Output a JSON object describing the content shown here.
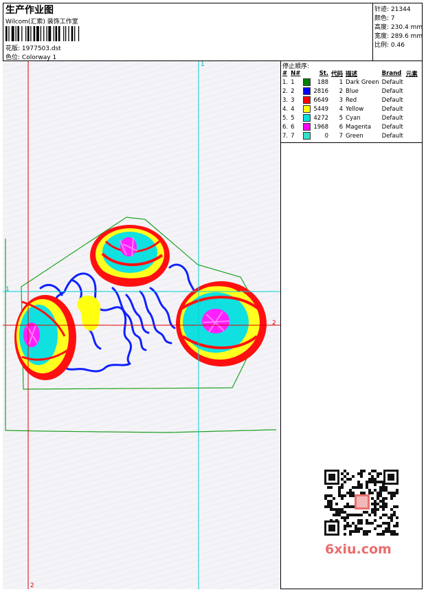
{
  "header": {
    "title": "生产作业图",
    "company": "Wilcom(汇索) 装饰工作室",
    "pattern_label": "花版:",
    "pattern_value": "1977503.dst",
    "colorway_label": "色位:",
    "colorway_value": "Colorway 1"
  },
  "stats": [
    {
      "label": "针迹:",
      "value": "21344"
    },
    {
      "label": "颜色:",
      "value": "7"
    },
    {
      "label": "高度:",
      "value": "230.4 mm"
    },
    {
      "label": "宽度:",
      "value": "289.6 mm"
    },
    {
      "label": "比例:",
      "value": "0.46"
    }
  ],
  "stop_sequence": {
    "title": "停止顺序:",
    "columns": [
      "#",
      "N#",
      "St.",
      "代码",
      "描述",
      "Brand",
      "元素"
    ],
    "rows": [
      {
        "num": "1.",
        "n": "1",
        "color": "#008000",
        "stitches": "188",
        "code": "1",
        "desc": "Dark Green",
        "brand": "Default"
      },
      {
        "num": "2.",
        "n": "2",
        "color": "#0000ff",
        "stitches": "2816",
        "code": "2",
        "desc": "Blue",
        "brand": "Default"
      },
      {
        "num": "3.",
        "n": "3",
        "color": "#ff0000",
        "stitches": "6649",
        "code": "3",
        "desc": "Red",
        "brand": "Default"
      },
      {
        "num": "4.",
        "n": "4",
        "color": "#ffff00",
        "stitches": "5449",
        "code": "4",
        "desc": "Yellow",
        "brand": "Default"
      },
      {
        "num": "5.",
        "n": "5",
        "color": "#00e0e0",
        "stitches": "4272",
        "code": "5",
        "desc": "Cyan",
        "brand": "Default"
      },
      {
        "num": "6.",
        "n": "6",
        "color": "#ff00ff",
        "stitches": "1968",
        "code": "6",
        "desc": "Magenta",
        "brand": "Default"
      },
      {
        "num": "7.",
        "n": "7",
        "color": "#33e0c8",
        "stitches": "0",
        "code": "7",
        "desc": "Green",
        "brand": "Default"
      }
    ]
  },
  "guides": {
    "label_1": "1",
    "label_2": "2"
  },
  "watermark": "6xiu.com",
  "colors": {
    "red_guide": "#e00000",
    "cyan_guide": "#00d0d0",
    "outline_green": "#20a020"
  }
}
